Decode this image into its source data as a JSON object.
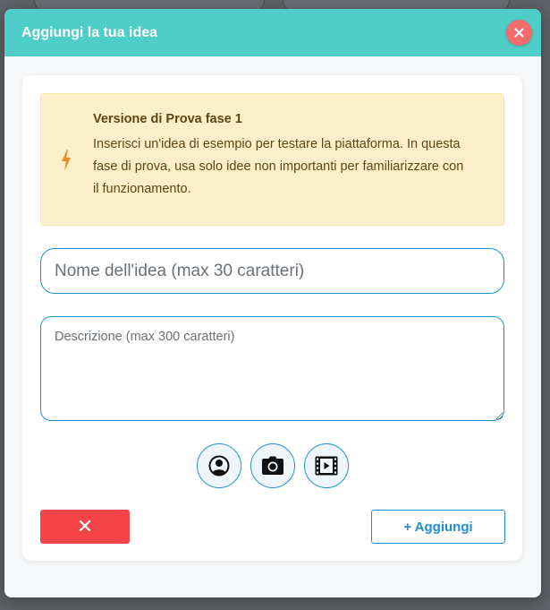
{
  "modal": {
    "title": "Aggiungi la tua idea",
    "close_icon": "close-icon"
  },
  "notice": {
    "icon": "lightning-icon",
    "title": "Versione di Prova fase 1",
    "text": "Inserisci un'idea di esempio per testare la piattaforma. In questa fase di prova, usa solo idee non importanti per familiarizzare con il funzionamento."
  },
  "form": {
    "name_value": "",
    "name_placeholder": "Nome dell'idea (max 30 caratteri)",
    "description_value": "",
    "description_placeholder": "Descrizione (max 300 caratteri)"
  },
  "media_buttons": [
    {
      "icon": "user-icon"
    },
    {
      "icon": "camera-icon"
    },
    {
      "icon": "video-icon"
    }
  ],
  "actions": {
    "cancel_label": "✕",
    "add_label": "+ Aggiungi"
  },
  "colors": {
    "header": "#4fcdc8",
    "close_button": "#f36b6b",
    "accent": "#1f8fd4",
    "cancel": "#f44448",
    "notice_bg": "#fdf0c9",
    "notice_icon": "#f08a24"
  }
}
